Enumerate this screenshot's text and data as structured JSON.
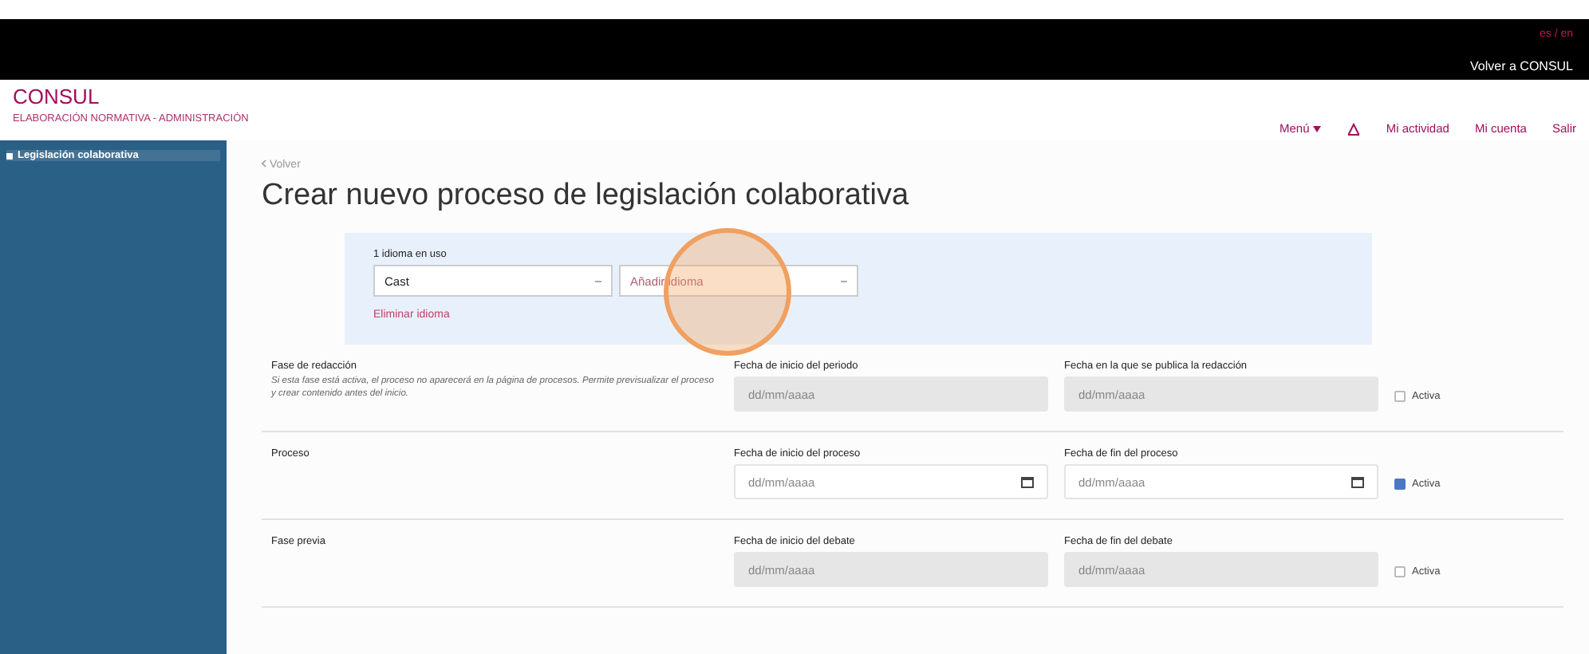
{
  "top_bar": {
    "locale": "es / en",
    "back_link": "Volver a CONSUL"
  },
  "header": {
    "logo": "CONSUL",
    "subtitle": "ELABORACIÓN NORMATIVA - ADMINISTRACIÓN",
    "nav": [
      {
        "label": "Menú",
        "kind": "dropdown"
      },
      {
        "kind": "home"
      },
      {
        "label": "Mi actividad",
        "kind": "link"
      },
      {
        "label": "Mi cuenta",
        "kind": "link"
      },
      {
        "label": "Salir",
        "kind": "link"
      }
    ]
  },
  "sidebar": {
    "items": [
      {
        "label": "Legislación colaborativa",
        "selected": true
      }
    ]
  },
  "back": "Volver",
  "title": "Crear nuevo proceso de legislación colaborativa",
  "languages": {
    "count_label": "1 idioma en uso",
    "current": "Cast",
    "add_placeholder": "Añadir idioma",
    "remove_link": "Eliminar idioma",
    "highlighted": true
  },
  "phases": [
    {
      "name": "Fase de redacción",
      "description": "Si esta fase está activa, el proceso no aparecerá en la página de procesos. Permite previsualizar el proceso y crear contenido antes del inicio.",
      "start_label": "Fecha de inicio del periodo",
      "start_placeholder": "dd/mm/aaaa",
      "end_label": "Fecha en la que se publica la redacción",
      "end_placeholder": "dd/mm/aaaa",
      "active_label": "Activa",
      "active": false
    },
    {
      "name": "Proceso",
      "start_label": "Fecha de inicio del proceso",
      "start_placeholder": "dd/mm/aaaa",
      "end_label": "Fecha de fin del proceso",
      "end_placeholder": "dd/mm/aaaa",
      "active_label": "Activa",
      "active": true
    },
    {
      "name": "Fase previa",
      "start_label": "Fecha de inicio del debate",
      "start_placeholder": "dd/mm/aaaa",
      "end_label": "Fecha de fin del debate",
      "end_placeholder": "dd/mm/aaaa",
      "active_label": "Activa",
      "active": false
    }
  ]
}
